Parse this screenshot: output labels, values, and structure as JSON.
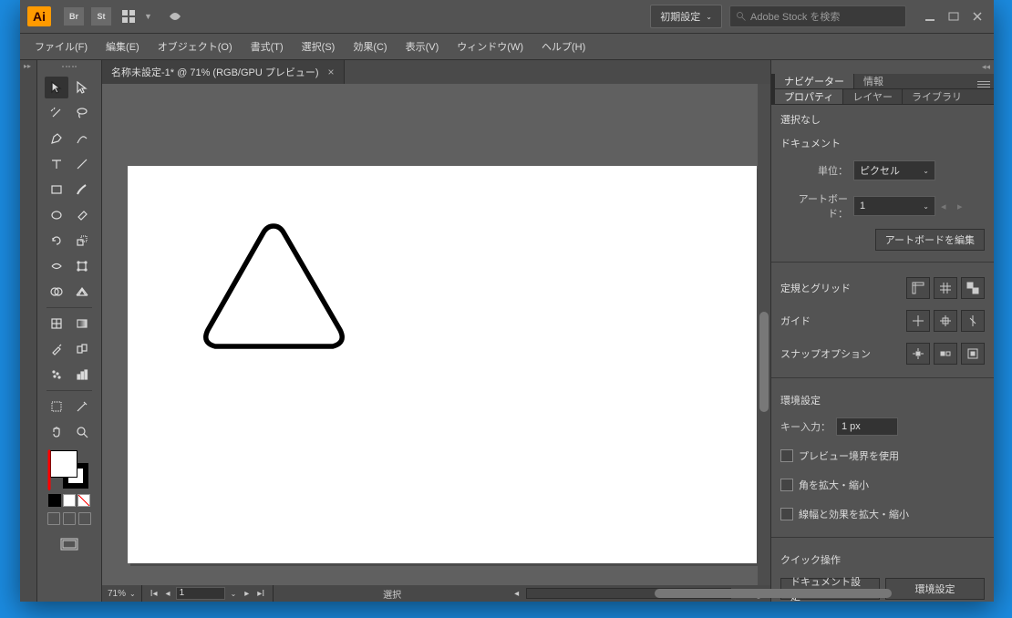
{
  "topbar": {
    "br_label": "Br",
    "st_label": "St",
    "workspace_label": "初期設定",
    "stock_placeholder": "Adobe Stock を検索"
  },
  "menu": {
    "file": "ファイル(F)",
    "edit": "編集(E)",
    "object": "オブジェクト(O)",
    "type": "書式(T)",
    "select": "選択(S)",
    "effect": "効果(C)",
    "view": "表示(V)",
    "window": "ウィンドウ(W)",
    "help": "ヘルプ(H)"
  },
  "doc": {
    "tab_title": "名称未設定-1* @ 71% (RGB/GPU プレビュー)"
  },
  "status": {
    "zoom": "71%",
    "page": "1",
    "selection": "選択"
  },
  "right": {
    "nav_tab": "ナビゲーター",
    "info_tab": "情報",
    "props_tab": "プロパティ",
    "layers_tab": "レイヤー",
    "lib_tab": "ライブラリ",
    "no_selection": "選択なし",
    "document_hdr": "ドキュメント",
    "units_label": "単位：",
    "units_value": "ピクセル",
    "artboard_label": "アートボード：",
    "artboard_value": "1",
    "edit_artboards": "アートボードを編集",
    "rulers_grid": "定規とグリッド",
    "guides": "ガイド",
    "snap_options": "スナップオプション",
    "prefs_hdr": "環境設定",
    "key_input_label": "キー入力：",
    "key_input_value": "1 px",
    "chk_preview": "プレビュー境界を使用",
    "chk_scale_corners": "角を拡大・縮小",
    "chk_scale_strokes": "線幅と効果を拡大・縮小",
    "quick_hdr": "クイック操作",
    "doc_setup": "ドキュメント設定",
    "env_prefs": "環境設定"
  }
}
